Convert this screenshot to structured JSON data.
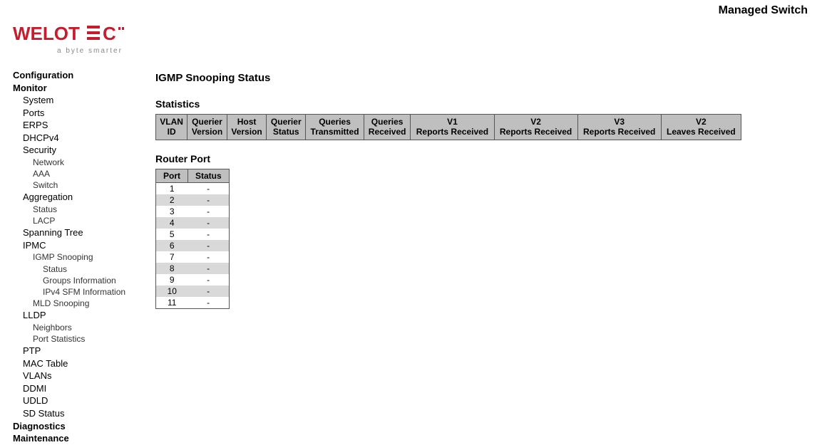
{
  "header": {
    "product": "Managed Switch"
  },
  "logo": {
    "name": "WELOTEC",
    "tagline": "a byte smarter"
  },
  "sidebar": {
    "configuration": "Configuration",
    "monitor": "Monitor",
    "system": "System",
    "ports": "Ports",
    "erps": "ERPS",
    "dhcpv4": "DHCPv4",
    "security": "Security",
    "network": "Network",
    "aaa": "AAA",
    "switch": "Switch",
    "aggregation": "Aggregation",
    "agg_status": "Status",
    "lacp": "LACP",
    "spanning_tree": "Spanning Tree",
    "ipmc": "IPMC",
    "igmp_snooping": "IGMP Snooping",
    "igmp_status": "Status",
    "igmp_groups": "Groups Information",
    "igmp_sfm": "IPv4 SFM Information",
    "mld_snooping": "MLD Snooping",
    "lldp": "LLDP",
    "lldp_neighbors": "Neighbors",
    "lldp_portstats": "Port Statistics",
    "ptp": "PTP",
    "mac_table": "MAC Table",
    "vlans": "VLANs",
    "ddmi": "DDMI",
    "udld": "UDLD",
    "sd_status": "SD Status",
    "diagnostics": "Diagnostics",
    "maintenance": "Maintenance"
  },
  "page": {
    "title": "IGMP Snooping Status",
    "statistics_label": "Statistics",
    "router_port_label": "Router Port"
  },
  "stats_table": {
    "headers": {
      "vlan_id": "VLAN ID",
      "querier_version": "Querier Version",
      "host_version": "Host Version",
      "querier_status": "Querier Status",
      "queries_transmitted": "Queries Transmitted",
      "queries_received": "Queries Received",
      "v1_reports": "V1 Reports Received",
      "v2_reports": "V2 Reports Received",
      "v3_reports": "V3 Reports Received",
      "v2_leaves": "V2 Leaves Received"
    }
  },
  "router_table": {
    "headers": {
      "port": "Port",
      "status": "Status"
    },
    "rows": [
      {
        "port": "1",
        "status": "-"
      },
      {
        "port": "2",
        "status": "-"
      },
      {
        "port": "3",
        "status": "-"
      },
      {
        "port": "4",
        "status": "-"
      },
      {
        "port": "5",
        "status": "-"
      },
      {
        "port": "6",
        "status": "-"
      },
      {
        "port": "7",
        "status": "-"
      },
      {
        "port": "8",
        "status": "-"
      },
      {
        "port": "9",
        "status": "-"
      },
      {
        "port": "10",
        "status": "-"
      },
      {
        "port": "11",
        "status": "-"
      }
    ]
  }
}
